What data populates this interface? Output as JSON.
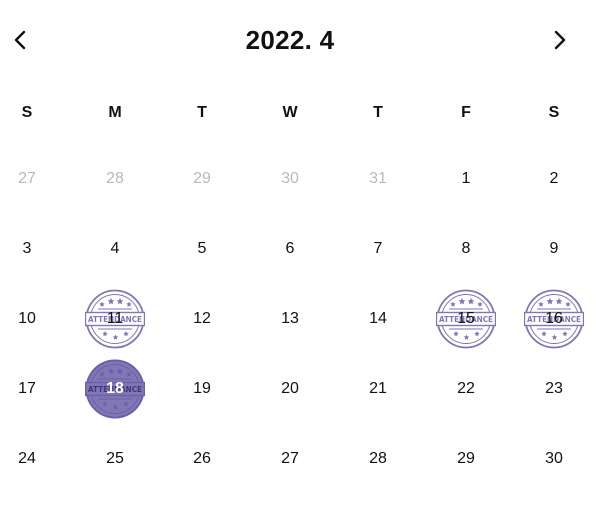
{
  "calendar": {
    "title": "2022. 4",
    "prev_icon": "chevron-left-icon",
    "next_icon": "chevron-right-icon",
    "weekdays": [
      "S",
      "M",
      "T",
      "W",
      "T",
      "F",
      "S"
    ],
    "stamp_text": "ATTENDANCE",
    "stamp_icon": "attendance-stamp-icon",
    "accent_color": "#6a5fa8",
    "weeks": [
      [
        {
          "label": "27",
          "muted": true
        },
        {
          "label": "28",
          "muted": true
        },
        {
          "label": "29",
          "muted": true
        },
        {
          "label": "30",
          "muted": true
        },
        {
          "label": "31",
          "muted": true
        },
        {
          "label": "1"
        },
        {
          "label": "2"
        }
      ],
      [
        {
          "label": "3"
        },
        {
          "label": "4"
        },
        {
          "label": "5"
        },
        {
          "label": "6"
        },
        {
          "label": "7"
        },
        {
          "label": "8"
        },
        {
          "label": "9"
        }
      ],
      [
        {
          "label": "10"
        },
        {
          "label": "11",
          "stamped": true
        },
        {
          "label": "12"
        },
        {
          "label": "13"
        },
        {
          "label": "14"
        },
        {
          "label": "15",
          "stamped": true
        },
        {
          "label": "16",
          "stamped": true
        }
      ],
      [
        {
          "label": "17"
        },
        {
          "label": "18",
          "stamped": true,
          "today": true
        },
        {
          "label": "19"
        },
        {
          "label": "20"
        },
        {
          "label": "21"
        },
        {
          "label": "22"
        },
        {
          "label": "23"
        }
      ],
      [
        {
          "label": "24"
        },
        {
          "label": "25"
        },
        {
          "label": "26"
        },
        {
          "label": "27"
        },
        {
          "label": "28"
        },
        {
          "label": "29"
        },
        {
          "label": "30"
        }
      ]
    ]
  }
}
